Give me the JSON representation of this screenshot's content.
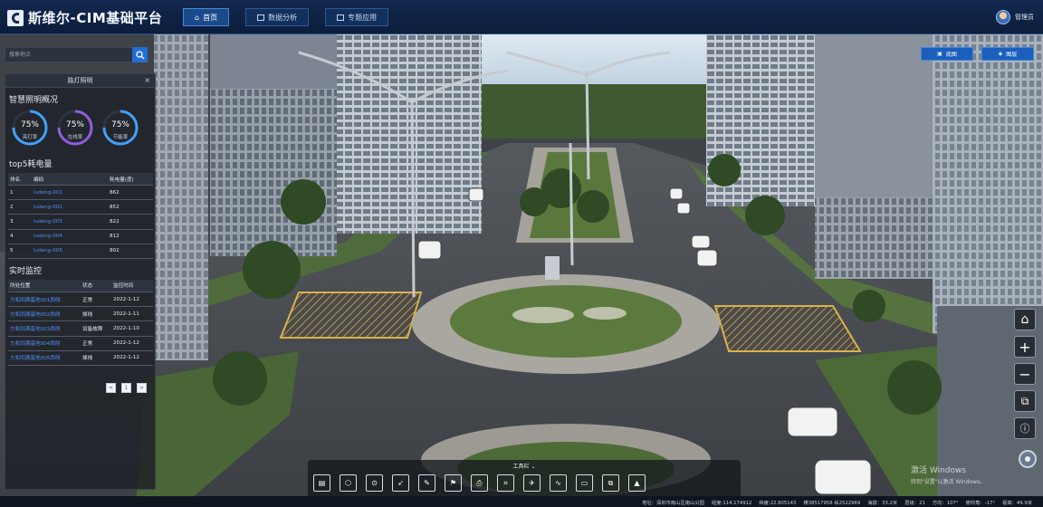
{
  "header": {
    "logo_text": "斯维尔-CIM基础平台",
    "nav": [
      {
        "label": "首页",
        "active": true,
        "icon": "home-icon"
      },
      {
        "label": "数据分析",
        "active": false,
        "icon": "chart-icon"
      },
      {
        "label": "专题应用",
        "active": false,
        "icon": "app-icon"
      }
    ],
    "user": "管理员"
  },
  "search": {
    "placeholder": "搜索地点"
  },
  "panel": {
    "title": "路灯照明",
    "overview_title": "智慧照明概况",
    "gauges": [
      {
        "value": "75%",
        "label": "亮灯率",
        "color": "#3fa1ff",
        "fraction": 0.75
      },
      {
        "value": "75%",
        "label": "在线率",
        "color": "#8e5fe0",
        "fraction": 0.75
      },
      {
        "value": "75%",
        "label": "节能率",
        "color": "#3fa1ff",
        "fraction": 0.75
      }
    ],
    "top5_title": "top5耗电量",
    "top5_headers": [
      "排名",
      "编码",
      "耗电量(度)"
    ],
    "top5_rows": [
      {
        "rank": "1",
        "code": "ludeng-001",
        "power": "862"
      },
      {
        "rank": "2",
        "code": "ludeng-002",
        "power": "852"
      },
      {
        "rank": "3",
        "code": "ludeng-003",
        "power": "822"
      },
      {
        "rank": "4",
        "code": "ludeng-004",
        "power": "812"
      },
      {
        "rank": "5",
        "code": "ludeng-005",
        "power": "802"
      }
    ],
    "monitor_title": "实时监控",
    "monitor_headers": [
      "所处位置",
      "状态",
      "监控时间"
    ],
    "monitor_rows": [
      {
        "location": "方和同满基地001西侧",
        "status": "正常",
        "time": "2022-1-12"
      },
      {
        "location": "方和同满基地002西侧",
        "status": "掉线",
        "time": "2022-1-11"
      },
      {
        "location": "方和同满基地003西侧",
        "status": "设备故障",
        "time": "2022-1-10"
      },
      {
        "location": "方和同满基地004西侧",
        "status": "正常",
        "time": "2022-1-12"
      },
      {
        "location": "方和同满基地005西侧",
        "status": "掉线",
        "time": "2022-1-12"
      }
    ],
    "pager": [
      "<",
      "1",
      ">"
    ]
  },
  "map_buttons": [
    {
      "label": "底图",
      "icon": "image-icon"
    },
    {
      "label": "图层",
      "icon": "layers-icon"
    }
  ],
  "toolbar": {
    "title": "工具栏 ⌄"
  },
  "watermark": {
    "line1": "激活 Windows",
    "line2": "转到\"设置\"以激活 Windows。"
  },
  "status": {
    "address": "地址：深圳市南山区南山公园",
    "lng": "经度:114.174912",
    "lat": "纬度:22.805143",
    "xy": "横38517958 纵2522969",
    "alt": "海拔：33.2米",
    "level": "层级：21",
    "heading": "方向：107°",
    "pitch": "俯仰角：-17°",
    "view": "视高：49.9米"
  }
}
